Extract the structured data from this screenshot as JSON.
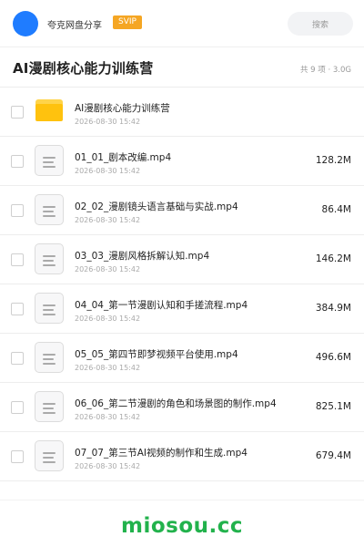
{
  "header": {
    "brand": "夸克网盘分享",
    "badge": "SVIP",
    "search_placeholder": "搜索"
  },
  "folder": {
    "title": "AI漫剧核心能力训练营",
    "meta": "共 9 项 · 3.0G"
  },
  "items": [
    {
      "type": "folder",
      "name": "AI漫剧核心能力训练营",
      "date": "2026-08-30 15:42",
      "size": ""
    },
    {
      "type": "file",
      "name": "01_01_剧本改编.mp4",
      "date": "2026-08-30 15:42",
      "size": "128.2M"
    },
    {
      "type": "file",
      "name": "02_02_漫剧镜头语言基础与实战.mp4",
      "date": "2026-08-30 15:42",
      "size": "86.4M"
    },
    {
      "type": "file",
      "name": "03_03_漫剧风格拆解认知.mp4",
      "date": "2026-08-30 15:42",
      "size": "146.2M"
    },
    {
      "type": "file",
      "name": "04_04_第一节漫剧认知和手搓流程.mp4",
      "date": "2026-08-30 15:42",
      "size": "384.9M"
    },
    {
      "type": "file",
      "name": "05_05_第四节即梦视频平台使用.mp4",
      "date": "2026-08-30 15:42",
      "size": "496.6M"
    },
    {
      "type": "file",
      "name": "06_06_第二节漫剧的角色和场景图的制作.mp4",
      "date": "2026-08-30 15:42",
      "size": "825.1M"
    },
    {
      "type": "file",
      "name": "07_07_第三节AI视频的制作和生成.mp4",
      "date": "2026-08-30 15:42",
      "size": "679.4M"
    }
  ],
  "watermark": "miosou.cc",
  "colors": {
    "accent": "#1f7cff",
    "svip": "#f5a623",
    "folder": "#ffc20e",
    "watermark": "#22b24c"
  }
}
